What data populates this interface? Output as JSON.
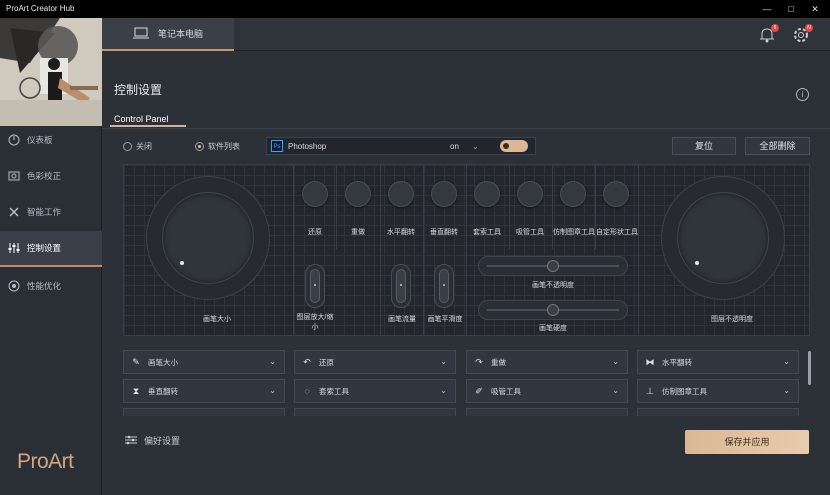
{
  "window": {
    "title": "ProArt Creator Hub",
    "controls": [
      "—",
      "□",
      "✕"
    ]
  },
  "sidebar": {
    "brand": "ProArt",
    "items": [
      {
        "label": "仪表板",
        "icon": "dashboard-icon"
      },
      {
        "label": "色彩校正",
        "icon": "color-calibration-icon"
      },
      {
        "label": "智能工作",
        "icon": "tools-icon"
      },
      {
        "label": "控制设置",
        "icon": "sliders-icon",
        "active": true
      },
      {
        "label": "性能优化",
        "icon": "performance-icon"
      }
    ]
  },
  "header": {
    "device_tab": "笔记本电脑",
    "notifications_badge": "6",
    "settings_badge": "N"
  },
  "page": {
    "title": "控制设置",
    "tab": "Control Panel"
  },
  "mode": {
    "off_label": "关闭",
    "app_list_label": "软件列表",
    "selected": "app_list"
  },
  "app_select": {
    "app": "Photoshop",
    "state": "on",
    "logo": "Ps"
  },
  "buttons": {
    "reset": "复位",
    "delete_all": "全部删除",
    "save_apply": "保存并应用"
  },
  "controls": {
    "left_dial": "画笔大小",
    "right_dial": "图层不透明度",
    "keys": [
      "还原",
      "重做",
      "水平翻转",
      "垂直翻转",
      "套索工具",
      "吸管工具",
      "仿制图章工具",
      "自定形状工具"
    ],
    "slider_zoom": "图层放大/缩小",
    "slider_flow": "画笔流量",
    "slider_smooth": "画笔平滑度",
    "slider_opacity": "画笔不透明度",
    "slider_hardness": "画笔硬度"
  },
  "assignments": [
    {
      "label": "画笔大小",
      "icon": "brush-icon"
    },
    {
      "label": "还原",
      "icon": "undo-icon"
    },
    {
      "label": "重做",
      "icon": "redo-icon"
    },
    {
      "label": "水平翻转",
      "icon": "flip-horizontal-icon"
    },
    {
      "label": "垂直翻转",
      "icon": "flip-vertical-icon"
    },
    {
      "label": "套索工具",
      "icon": "lasso-icon"
    },
    {
      "label": "吸管工具",
      "icon": "eyedropper-icon"
    },
    {
      "label": "仿制图章工具",
      "icon": "stamp-icon"
    }
  ],
  "footer": {
    "prefs_label": "偏好设置"
  },
  "colors": {
    "accent": "#d9b895",
    "background": "#2c3037",
    "sidebar": "#2a2e35"
  }
}
